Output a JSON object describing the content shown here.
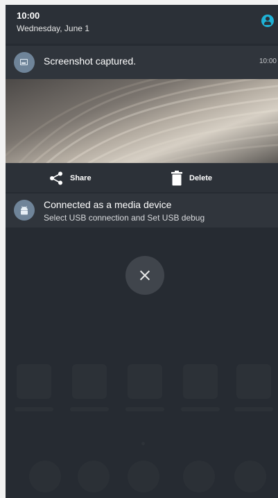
{
  "header": {
    "time": "10:00",
    "date": "Wednesday, June 1"
  },
  "screenshot_notification": {
    "title": "Screenshot captured.",
    "time": "10:00",
    "actions": {
      "share_label": "Share",
      "delete_label": "Delete"
    }
  },
  "usb_notification": {
    "title": "Connected as a media device",
    "subtitle": "Select USB connection and Set USB debug"
  },
  "colors": {
    "panel_background": "#262b32",
    "notification_background": "#30353c",
    "user_icon_accent": "#1fb2d6",
    "notification_icon": "#6f8499"
  },
  "icons": {
    "user": "account-circle-icon",
    "screenshot": "image-icon",
    "share": "share-icon",
    "delete": "trash-icon",
    "usb": "android-icon",
    "dismiss": "close-icon"
  }
}
